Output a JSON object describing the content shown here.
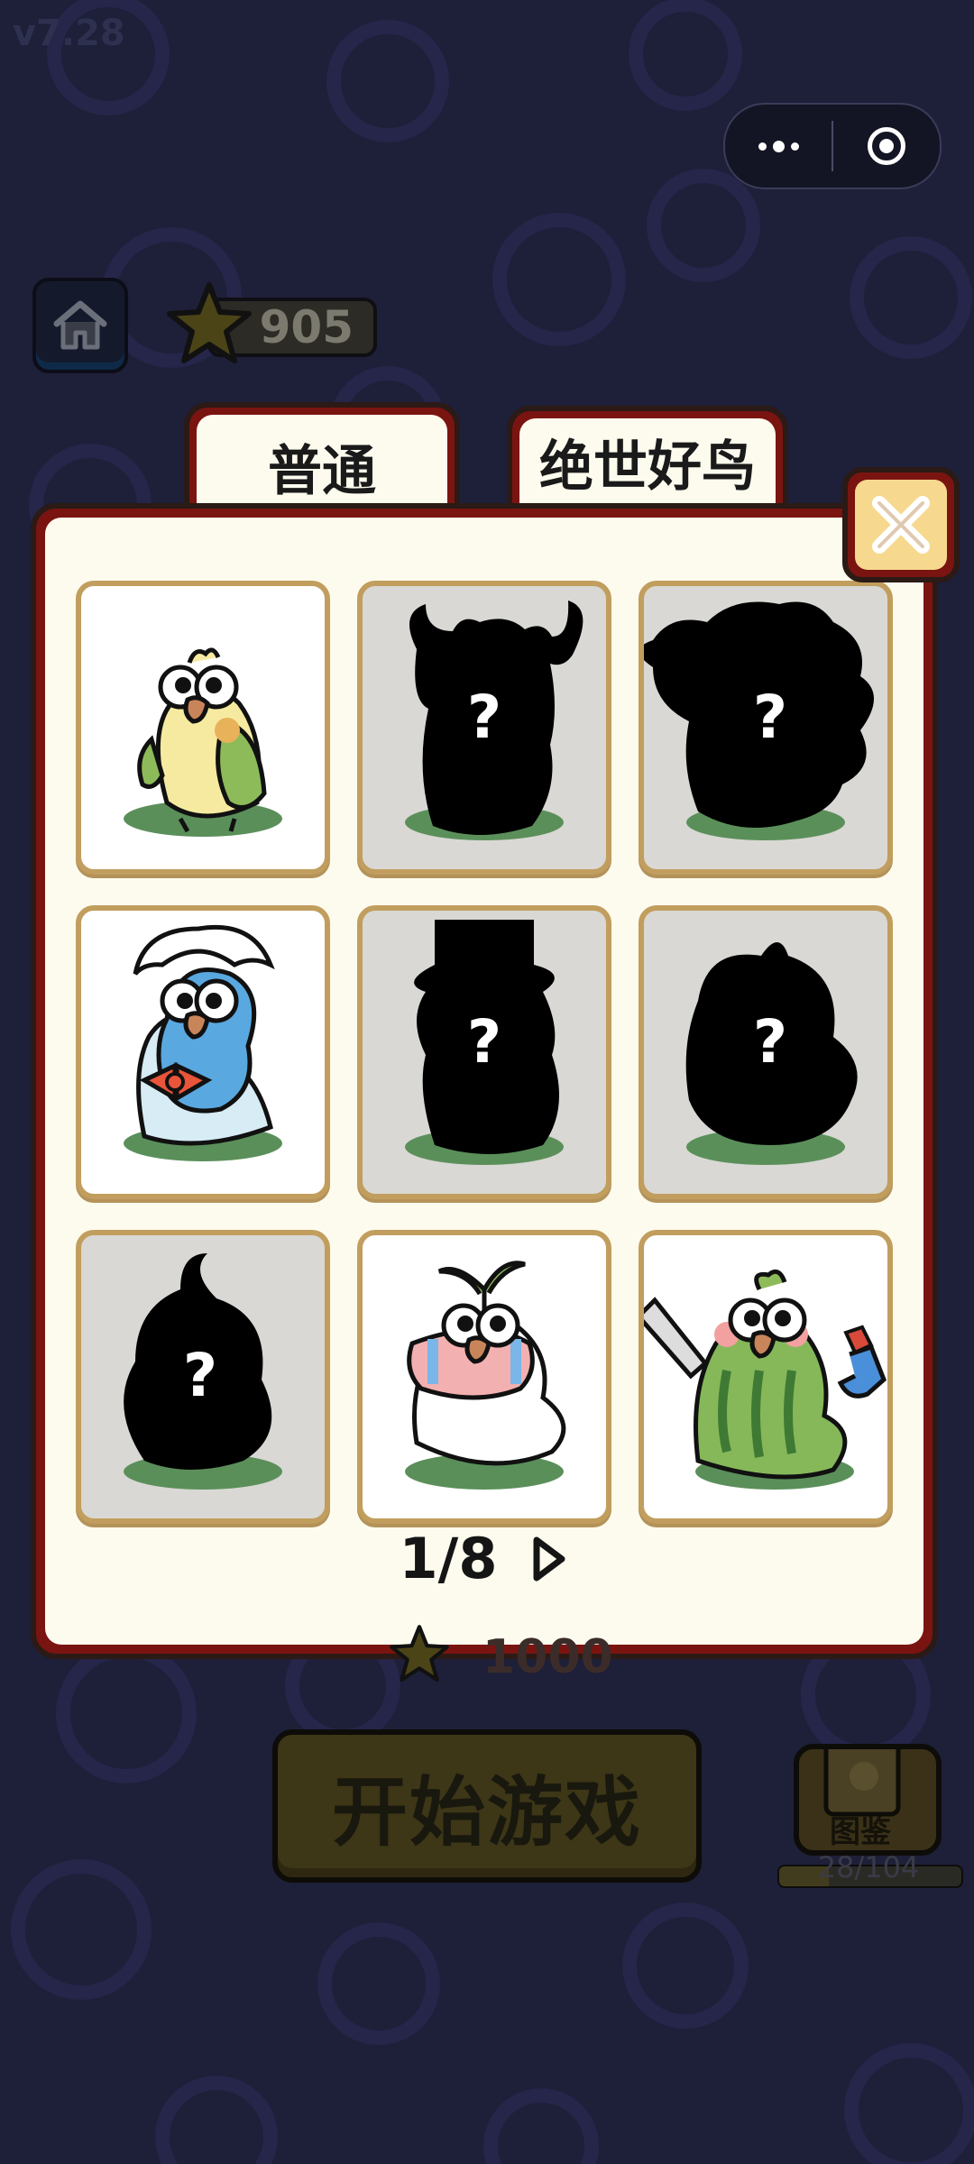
{
  "version": "v7.28",
  "header": {
    "star_count": "905"
  },
  "tabs": [
    {
      "label": "普通",
      "active": true
    },
    {
      "label": "绝世好鸟",
      "active": false
    }
  ],
  "cards": [
    {
      "state": "unlocked",
      "bird": "yellow-cockatiel-icon"
    },
    {
      "state": "locked",
      "mark": "?",
      "bird": "antler-bird-silhouette-icon"
    },
    {
      "state": "locked",
      "mark": "?",
      "bird": "fluffy-bird-silhouette-icon"
    },
    {
      "state": "unlocked",
      "bird": "maid-bird-icon"
    },
    {
      "state": "locked",
      "mark": "?",
      "bird": "top-hat-bird-silhouette-icon"
    },
    {
      "state": "locked",
      "mark": "?",
      "bird": "round-bird-silhouette-icon"
    },
    {
      "state": "locked",
      "mark": "?",
      "bird": "gourd-bird-silhouette-icon"
    },
    {
      "state": "unlocked",
      "bird": "sprout-crying-bird-icon"
    },
    {
      "state": "unlocked",
      "bird": "watermelon-knife-bird-icon"
    }
  ],
  "pager": {
    "text": "1/8"
  },
  "start_button": {
    "label": "开始游戏",
    "cost": "1000"
  },
  "guide": {
    "label": "图鉴",
    "progress": "28/104",
    "fraction": 0.27
  },
  "colors": {
    "background": "#1e1f38",
    "panel_frame": "#7a1410",
    "panel_fill": "#fdfbee",
    "card_border": "#c19e5e",
    "locked_card": "#d9d8d4",
    "close_button": "#f6d98f"
  }
}
